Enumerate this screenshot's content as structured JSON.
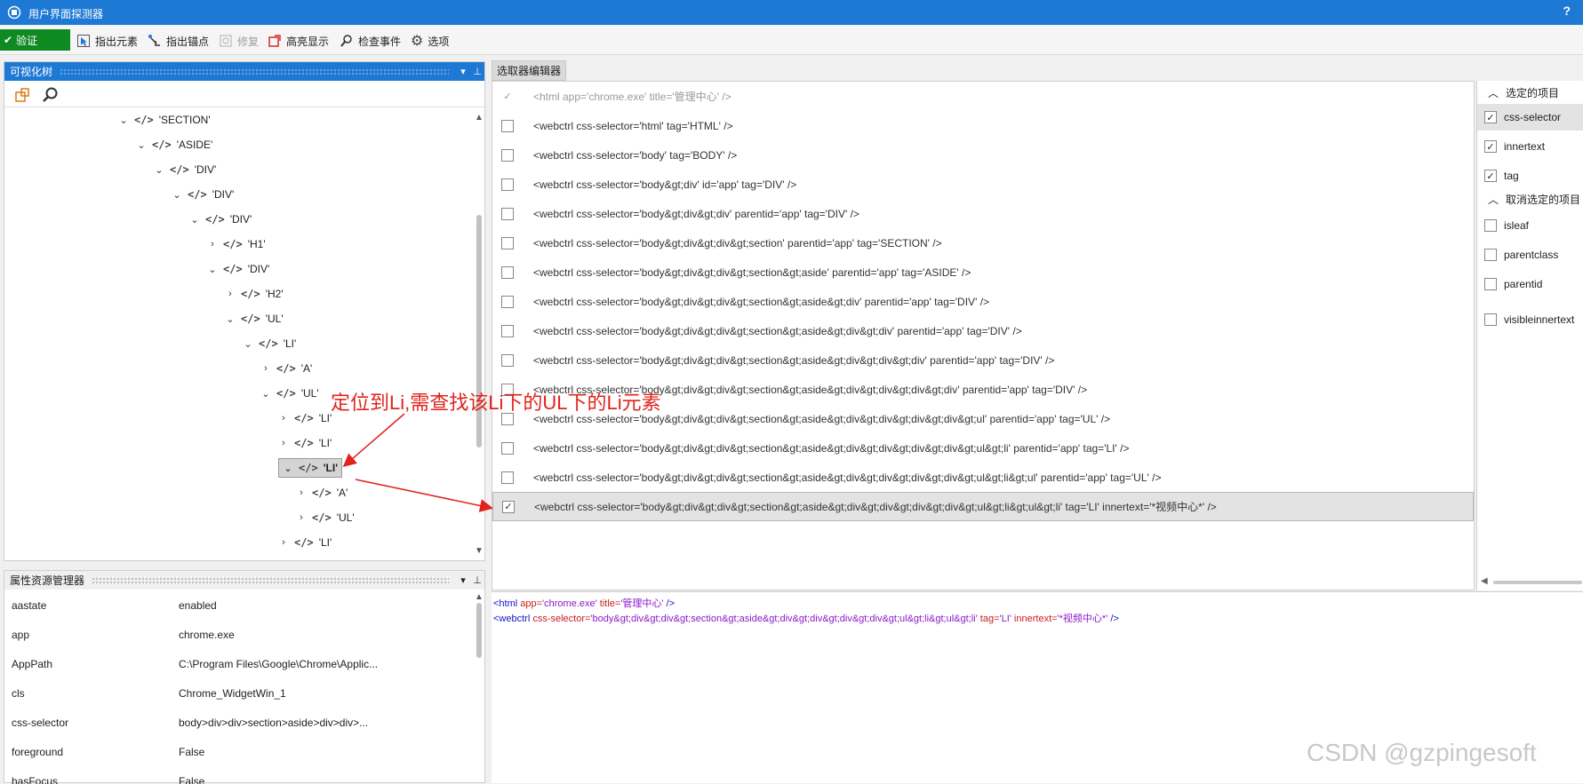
{
  "titlebar": {
    "title": "用户界面探测器",
    "help": "?"
  },
  "toolbar": {
    "validate": "验证",
    "indicate_element": "指出元素",
    "indicate_anchor": "指出锚点",
    "repair": "修复",
    "highlight": "高亮显示",
    "inspect_events": "检查事件",
    "options": "选项"
  },
  "tree_panel": {
    "title": "可视化树",
    "nodes": [
      {
        "label": "'SECTION'",
        "depth": 0,
        "expanded": true
      },
      {
        "label": "'ASIDE'",
        "depth": 1,
        "expanded": true
      },
      {
        "label": "'DIV'",
        "depth": 2,
        "expanded": true
      },
      {
        "label": "'DIV'",
        "depth": 3,
        "expanded": true
      },
      {
        "label": "'DIV'",
        "depth": 4,
        "expanded": true
      },
      {
        "label": "'H1'",
        "depth": 5,
        "expanded": false
      },
      {
        "label": "'DIV'",
        "depth": 5,
        "expanded": true
      },
      {
        "label": "'H2'",
        "depth": 6,
        "expanded": false
      },
      {
        "label": "'UL'",
        "depth": 6,
        "expanded": true
      },
      {
        "label": "'LI'",
        "depth": 7,
        "expanded": true
      },
      {
        "label": "'A'",
        "depth": 8,
        "expanded": false
      },
      {
        "label": "'UL'",
        "depth": 8,
        "expanded": true
      },
      {
        "label": "'LI'",
        "depth": 9,
        "expanded": false
      },
      {
        "label": "'LI'",
        "depth": 9,
        "expanded": false
      },
      {
        "label": "'LI'",
        "depth": 9,
        "expanded": true,
        "selected": true
      },
      {
        "label": "'A'",
        "depth": 10,
        "expanded": false
      },
      {
        "label": "'UL'",
        "depth": 10,
        "expanded": false
      },
      {
        "label": "'LI'",
        "depth": 9,
        "expanded": false
      }
    ]
  },
  "props_panel": {
    "title": "属性资源管理器",
    "rows": [
      {
        "key": "aastate",
        "value": "enabled"
      },
      {
        "key": "app",
        "value": "chrome.exe"
      },
      {
        "key": "AppPath",
        "value": "C:\\Program Files\\Google\\Chrome\\Applic..."
      },
      {
        "key": "cls",
        "value": "Chrome_WidgetWin_1"
      },
      {
        "key": "css-selector",
        "value": "body>div>div>section>aside>div>div>..."
      },
      {
        "key": "foreground",
        "value": "False"
      },
      {
        "key": "hasFocus",
        "value": "False"
      }
    ]
  },
  "selector_editor": {
    "tab": "选取器编辑器",
    "rows": [
      {
        "text": "<html app='chrome.exe' title='管理中心' />",
        "checked": true,
        "dim": true
      },
      {
        "text": "<webctrl css-selector='html' tag='HTML' />",
        "checked": false
      },
      {
        "text": "<webctrl css-selector='body' tag='BODY' />",
        "checked": false
      },
      {
        "text": "<webctrl css-selector='body&gt;div' id='app' tag='DIV' />",
        "checked": false
      },
      {
        "text": "<webctrl css-selector='body&gt;div&gt;div' parentid='app' tag='DIV' />",
        "checked": false
      },
      {
        "text": "<webctrl css-selector='body&gt;div&gt;div&gt;section' parentid='app' tag='SECTION' />",
        "checked": false
      },
      {
        "text": "<webctrl css-selector='body&gt;div&gt;div&gt;section&gt;aside' parentid='app' tag='ASIDE' />",
        "checked": false
      },
      {
        "text": "<webctrl css-selector='body&gt;div&gt;div&gt;section&gt;aside&gt;div' parentid='app' tag='DIV' />",
        "checked": false
      },
      {
        "text": "<webctrl css-selector='body&gt;div&gt;div&gt;section&gt;aside&gt;div&gt;div' parentid='app' tag='DIV' />",
        "checked": false
      },
      {
        "text": "<webctrl css-selector='body&gt;div&gt;div&gt;section&gt;aside&gt;div&gt;div&gt;div' parentid='app' tag='DIV' />",
        "checked": false
      },
      {
        "text": "<webctrl css-selector='body&gt;div&gt;div&gt;section&gt;aside&gt;div&gt;div&gt;div&gt;div' parentid='app' tag='DIV' />",
        "checked": false
      },
      {
        "text": "<webctrl css-selector='body&gt;div&gt;div&gt;section&gt;aside&gt;div&gt;div&gt;div&gt;div&gt;ul' parentid='app' tag='UL' />",
        "checked": false
      },
      {
        "text": "<webctrl css-selector='body&gt;div&gt;div&gt;section&gt;aside&gt;div&gt;div&gt;div&gt;div&gt;ul&gt;li' parentid='app' tag='LI' />",
        "checked": false
      },
      {
        "text": "<webctrl css-selector='body&gt;div&gt;div&gt;section&gt;aside&gt;div&gt;div&gt;div&gt;div&gt;ul&gt;li&gt;ul' parentid='app' tag='UL' />",
        "checked": false
      },
      {
        "text": "<webctrl css-selector='body&gt;div&gt;div&gt;section&gt;aside&gt;div&gt;div&gt;div&gt;div&gt;ul&gt;li&gt;ul&gt;li' tag='LI' innertext='*视频中心*' />",
        "checked": true,
        "selected": true
      }
    ]
  },
  "attributes": {
    "selected_group": "选定的项目",
    "unselected_group": "取消选定的项目",
    "selected": [
      "css-selector",
      "innertext",
      "tag"
    ],
    "unselected": [
      "isleaf",
      "parentclass",
      "parentid",
      "visibleinnertext"
    ]
  },
  "xml_preview": {
    "line1": {
      "open": "<html ",
      "a1": "app=",
      "v1": "'chrome.exe'",
      "a2": " title=",
      "v2": "'管理中心'",
      "close": " />"
    },
    "line2": {
      "open": "<webctrl ",
      "a1": "css-selector=",
      "v1": "'body&gt;div&gt;div&gt;section&gt;aside&gt;div&gt;div&gt;div&gt;div&gt;ul&gt;li&gt;ul&gt;li'",
      "a2": " tag=",
      "v2": "'LI'",
      "a3": " innertext=",
      "v3": "'*视频中心*'",
      "close": " />"
    }
  },
  "annotation": "定位到Li,需查找该Li下的UL下的Li元素",
  "watermark": "CSDN @gzpingesoft",
  "colors": {
    "titlebar": "#1e79d4",
    "validate": "#0f8a23",
    "annotation": "#e0231c"
  }
}
